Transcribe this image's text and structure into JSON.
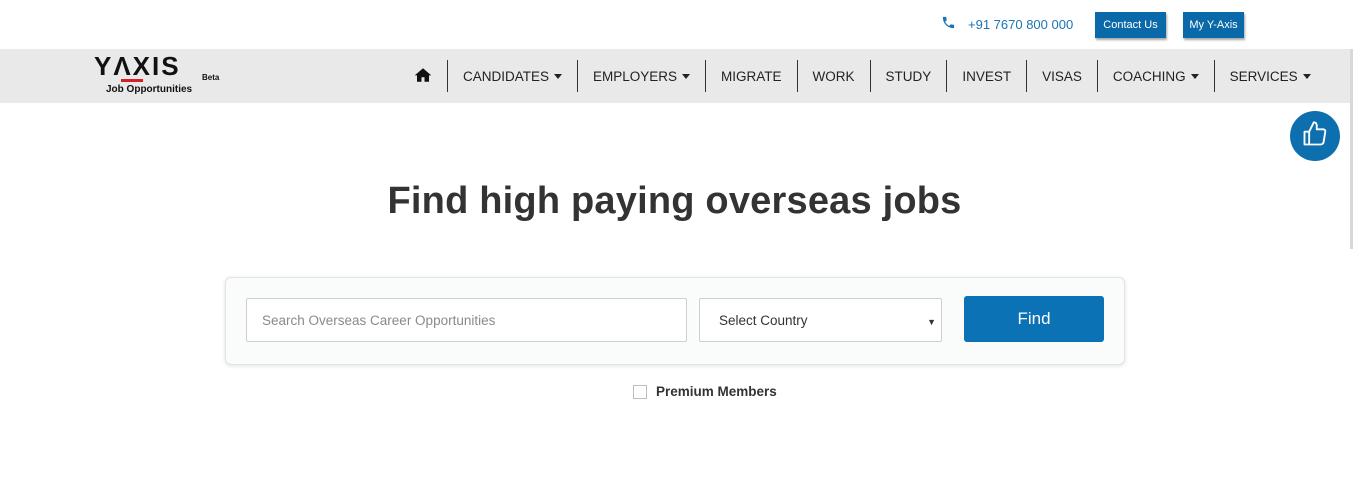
{
  "topbar": {
    "phone": "+91 7670 800 000",
    "contact_label": "Contact Us",
    "myaxis_label": "My Y-Axis"
  },
  "logo": {
    "main": "YΛXIS",
    "beta": "Beta",
    "sub": "Job Opportunities"
  },
  "nav": {
    "items": [
      {
        "label": "CANDIDATES",
        "dropdown": true
      },
      {
        "label": "EMPLOYERS",
        "dropdown": true
      },
      {
        "label": "MIGRATE",
        "dropdown": false
      },
      {
        "label": "WORK",
        "dropdown": false
      },
      {
        "label": "STUDY",
        "dropdown": false
      },
      {
        "label": "INVEST",
        "dropdown": false
      },
      {
        "label": "VISAS",
        "dropdown": false
      },
      {
        "label": "COACHING",
        "dropdown": true
      },
      {
        "label": "SERVICES",
        "dropdown": true
      }
    ]
  },
  "hero": {
    "headline": "Find high paying overseas jobs"
  },
  "search": {
    "placeholder": "Search Overseas Career Opportunities",
    "value": "",
    "country_selected": "Select Country",
    "find_label": "Find",
    "premium_label": "Premium Members",
    "premium_checked": false
  },
  "colors": {
    "accent": "#0a72b5",
    "nav_bg": "#e9e9e9",
    "logo_red": "#d81f26"
  }
}
